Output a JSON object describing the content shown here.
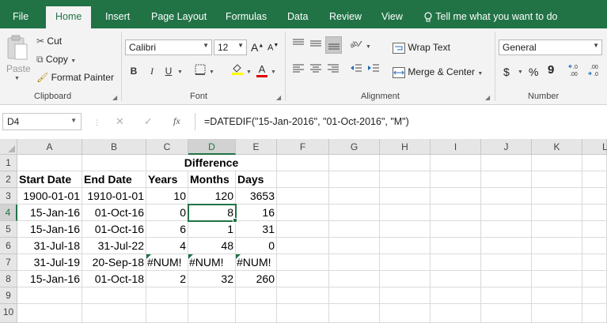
{
  "tabs": [
    {
      "label": "File",
      "active": false
    },
    {
      "label": "Home",
      "active": true
    },
    {
      "label": "Insert",
      "active": false
    },
    {
      "label": "Page Layout",
      "active": false
    },
    {
      "label": "Formulas",
      "active": false
    },
    {
      "label": "Data",
      "active": false
    },
    {
      "label": "Review",
      "active": false
    },
    {
      "label": "View",
      "active": false
    }
  ],
  "tell_me": "Tell me what you want to do",
  "clipboard": {
    "paste": "Paste",
    "cut": "Cut",
    "copy": "Copy",
    "format_painter": "Format Painter",
    "group": "Clipboard"
  },
  "font": {
    "name": "Calibri",
    "size": "12",
    "grow": "A",
    "shrink": "A",
    "bold": "B",
    "italic": "I",
    "underline": "U",
    "font_color_letter": "A",
    "group": "Font"
  },
  "alignment": {
    "wrap_text": "Wrap Text",
    "merge_center": "Merge & Center",
    "group": "Alignment"
  },
  "number": {
    "format": "General",
    "currency": "$",
    "percent": "%",
    "comma": "9",
    "group": "Number"
  },
  "formula_bar": {
    "name_box": "D4",
    "fx": "fx",
    "formula": "=DATEDIF(\"15-Jan-2016\", \"01-Oct-2016\", \"M\")"
  },
  "columns": [
    "A",
    "B",
    "C",
    "D",
    "E",
    "F",
    "G",
    "H",
    "I",
    "J",
    "K",
    "L"
  ],
  "rows": [
    "1",
    "2",
    "3",
    "4",
    "5",
    "6",
    "7",
    "8",
    "9",
    "10"
  ],
  "selected": {
    "column": "D",
    "row": "4"
  },
  "sheet": {
    "row1": {
      "difference": "Difference"
    },
    "row2": {
      "a": "Start Date",
      "b": "End Date",
      "c": "Years",
      "d": "Months",
      "e": "Days"
    },
    "data": [
      {
        "a": "1900-01-01",
        "b": "1910-01-01",
        "c": "10",
        "d": "120",
        "e": "3653"
      },
      {
        "a": "15-Jan-16",
        "b": "01-Oct-16",
        "c": "0",
        "d": "8",
        "e": "16"
      },
      {
        "a": "15-Jan-16",
        "b": "01-Oct-16",
        "c": "6",
        "d": "1",
        "e": "31"
      },
      {
        "a": "31-Jul-18",
        "b": "31-Jul-22",
        "c": "4",
        "d": "48",
        "e": "0"
      },
      {
        "a": "31-Jul-19",
        "b": "20-Sep-18",
        "c": "#NUM!",
        "d": "#NUM!",
        "e": "#NUM!"
      },
      {
        "a": "15-Jan-16",
        "b": "01-Oct-18",
        "c": "2",
        "d": "32",
        "e": "260"
      }
    ]
  },
  "colors": {
    "accent": "#217346"
  }
}
